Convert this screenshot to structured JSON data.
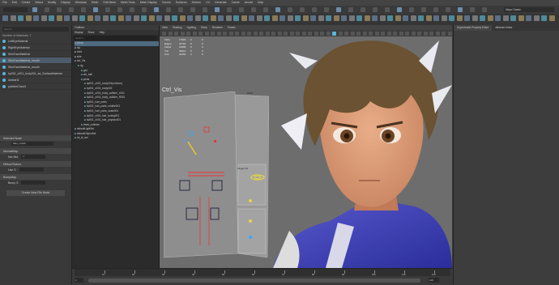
{
  "menubar": [
    "File",
    "Edit",
    "Create",
    "Select",
    "Modify",
    "Display",
    "Windows",
    "Mesh",
    "Edit Mesh",
    "Mesh Tools",
    "Mesh Display",
    "Curves",
    "Surfaces",
    "Deform",
    "UV",
    "Generate",
    "Cache",
    "Arnold",
    "Help"
  ],
  "workspace": "Maya Classic",
  "left_panel": {
    "search_placeholder": "Search",
    "header": "Number of Materials: 7",
    "materials": [
      "LeftEyeMaterial",
      "RightEyeMaterial",
      "SkinFaceMaterial",
      "SkinFaceMaterial_mouth",
      "SkinFaceMaterial_mouth",
      "hp001_c001_body001_sd_SurfaceMaterial",
      "lambert1",
      "particleCloud1"
    ],
    "attr_title": "Selected Node",
    "attr_node": "Skin_mouth",
    "sections": [
      {
        "name": "NormalMap",
        "label": "Nor Mul",
        "value": "1"
      },
      {
        "name": "DiffuseTexture",
        "label": "Use S",
        "value": ""
      },
      {
        "name": "BumpMap",
        "label": "Bump S",
        "value": ""
      }
    ],
    "create_button": "Create New File Node"
  },
  "outliner": {
    "title": "Outliner",
    "menu": [
      "Display",
      "Show",
      "Help"
    ],
    "search_placeholder": "Search...",
    "items": [
      "persp",
      "top",
      "front",
      "side",
      "ctrl_Vis",
      "rig",
      "geo",
      "ctrl_ball",
      "joints",
      "hp001_c001_body001(uniform)",
      "hp001_c001_body002",
      "hp001_c001_body_collider_L001",
      "hp001_c001_body_collider_R001",
      "hp001_hair_parts",
      "hp001_hair_parts_middle001",
      "hp001_hair_parts_scale001",
      "hp001_c001_hair_tuning001",
      "hp001_c001_hair_physics001",
      "head_collision",
      "defaultLightSet",
      "defaultObjectSet",
      "mi_sf_set"
    ]
  },
  "viewport": {
    "menu": [
      "View",
      "Shading",
      "Lighting",
      "Show",
      "Renderer",
      "Panels"
    ],
    "camera": "persp",
    "hud_rows": [
      {
        "label": "Verts",
        "a": "17822",
        "b": "0",
        "c": "0"
      },
      {
        "label": "Edges",
        "a": "34791",
        "b": "0",
        "c": "0"
      },
      {
        "label": "Faces",
        "a": "16955",
        "b": "0",
        "c": "0"
      },
      {
        "label": "Tris",
        "a": "32614",
        "b": "0",
        "c": "0"
      },
      {
        "label": "UVs",
        "a": "22453",
        "b": "0",
        "c": "0"
      }
    ],
    "ctrl_label": "Ctrl_Vis",
    "fk_label": "IK/FK",
    "ctrl_label2": "Finger FK"
  },
  "right_panel": {
    "tabs": [
      "Hypershade Property Editor",
      "Attribute Editor"
    ]
  },
  "time_slider": {
    "start": "1",
    "end": "120",
    "ticks": [
      "10",
      "20",
      "30",
      "40",
      "50",
      "60",
      "70",
      "80",
      "90",
      "100",
      "110",
      "120"
    ],
    "range_start": "1",
    "range_end": "120"
  },
  "colors": {
    "accent": "#5ab4d8",
    "highlight": "#e2b04a",
    "viewport_bg": "#6d6d6d"
  }
}
